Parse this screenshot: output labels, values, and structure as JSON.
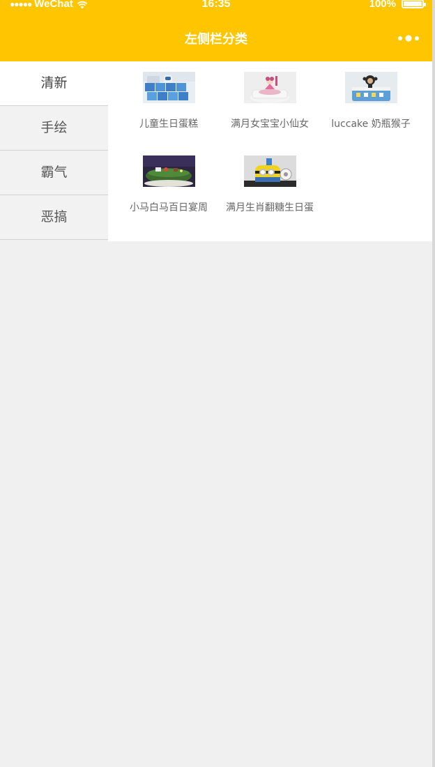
{
  "status_bar": {
    "carrier": "WeChat",
    "time": "16:35",
    "battery": "100%"
  },
  "nav": {
    "title": "左侧栏分类",
    "menu_icon": "more-dots-icon"
  },
  "colors": {
    "header": "#ffc600",
    "sidebar_bg": "#f2f2f2",
    "sidebar_active_bg": "#ffffff",
    "page_bg": "#f0f0f0"
  },
  "sidebar": {
    "active_index": 0,
    "items": [
      {
        "label": "清新"
      },
      {
        "label": "手绘"
      },
      {
        "label": "霸气"
      },
      {
        "label": "恶搞"
      }
    ]
  },
  "products": [
    {
      "name": "儿童生日蛋糕",
      "image": "blue-block-cake-thumbnail"
    },
    {
      "name": "满月女宝宝小仙女",
      "image": "pink-fairy-cake-thumbnail"
    },
    {
      "name": "luccake 奶瓶猴子",
      "image": "monkey-bottle-cake-thumbnail"
    },
    {
      "name": "小马白马百日宴周",
      "image": "green-pony-cake-thumbnail"
    },
    {
      "name": "满月生肖翻糖生日蛋",
      "image": "yellow-minion-cake-thumbnail"
    }
  ]
}
